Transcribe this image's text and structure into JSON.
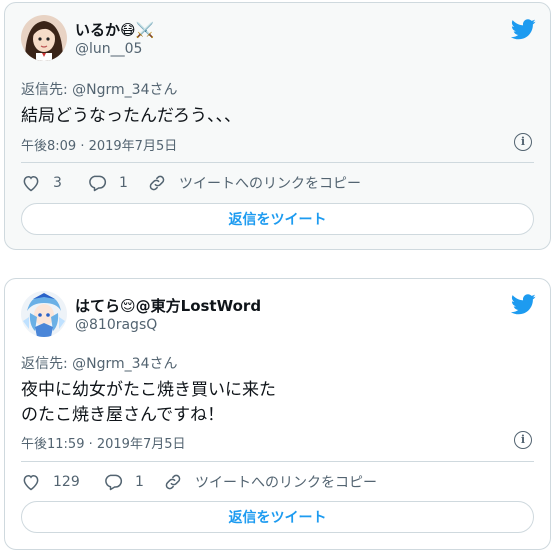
{
  "tweets": [
    {
      "display_name": "いるか😷⚔️",
      "handle": "@lun__05",
      "reply_to": "返信先: @Ngrm_34さん",
      "body": [
        "結局どうなったんだろう、、、"
      ],
      "timestamp": "午後8:09 · 2019年7月5日",
      "likes": "3",
      "replies": "1",
      "copy_link_label": "ツイートへのリンクをコピー",
      "reply_button_label": "返信をツイート"
    },
    {
      "display_name": "はてら😌@東方LostWord",
      "handle": "@810ragsQ",
      "reply_to": "返信先: @Ngrm_34さん",
      "body": [
        "夜中に幼女がたこ焼き買いに来た",
        "のたこ焼き屋さんですね！"
      ],
      "timestamp": "午後11:59 · 2019年7月5日",
      "likes": "129",
      "replies": "1",
      "copy_link_label": "ツイートへのリンクをコピー",
      "reply_button_label": "返信をツイート"
    }
  ],
  "icons": {
    "brand": "twitter-bird-icon",
    "info": "info-icon",
    "like": "heart-icon",
    "reply": "reply-icon",
    "link": "link-icon"
  },
  "colors": {
    "brand_blue": "#1d9bf0",
    "text_secondary": "#536471",
    "border": "#cfd9de",
    "card1_background": "#f7f9f9"
  }
}
